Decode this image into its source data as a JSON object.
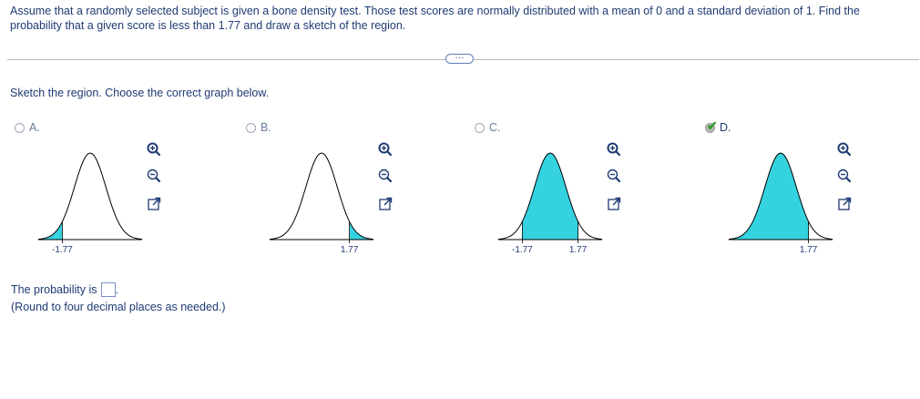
{
  "question": {
    "text": "Assume that a randomly selected subject is given a bone density test. Those test scores are normally distributed with a mean of 0 and a standard deviation of 1. Find the probability that a given score is less than 1.77 and draw a sketch of the region."
  },
  "more_button": {
    "label": "···"
  },
  "instruction": "Sketch the region. Choose the correct graph below.",
  "options": [
    {
      "letter": "A.",
      "selected": false,
      "shaded": "left-tail",
      "ticks": [
        "-1.77"
      ],
      "tick_values": [
        -1.77
      ]
    },
    {
      "letter": "B.",
      "selected": false,
      "shaded": "right-tail",
      "ticks": [
        "1.77"
      ],
      "tick_values": [
        1.77
      ]
    },
    {
      "letter": "C.",
      "selected": false,
      "shaded": "between",
      "ticks": [
        "-1.77",
        "1.77"
      ],
      "tick_values": [
        -1.77,
        1.77
      ]
    },
    {
      "letter": "D.",
      "selected": true,
      "shaded": "left-of",
      "ticks": [
        "1.77"
      ],
      "tick_values": [
        1.77
      ]
    }
  ],
  "tools": [
    "zoom-in-icon",
    "zoom-out-icon",
    "pop-out-icon"
  ],
  "colors": {
    "shade": "#35d3e0",
    "text": "#1f3b73",
    "check": "#2e9b2e"
  },
  "answer": {
    "prefix": "The probability is",
    "suffix": ".",
    "note": "(Round to four decimal places as needed.)"
  }
}
